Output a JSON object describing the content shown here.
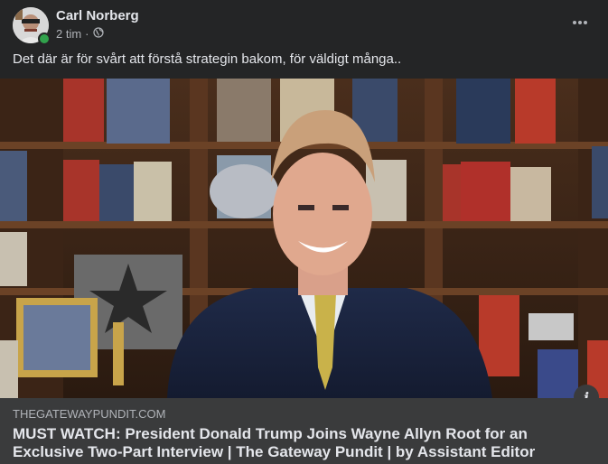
{
  "post": {
    "author": "Carl Norberg",
    "time": "2 tim",
    "separator": "·",
    "privacy_icon": "globe-icon",
    "more_icon": "more-options-icon",
    "text": "Det där är för svårt att förstå strategin bakom, för väldigt många.."
  },
  "link_preview": {
    "domain": "THEGATEWAYPUNDIT.COM",
    "title": "MUST WATCH: President Donald Trump Joins Wayne Allyn Root for an Exclusive Two-Part Interview | The Gateway Pundit | by Assistant Editor",
    "info_label": "i"
  },
  "colors": {
    "background": "#242526",
    "link_box": "#3a3b3c",
    "online": "#31a24c"
  }
}
